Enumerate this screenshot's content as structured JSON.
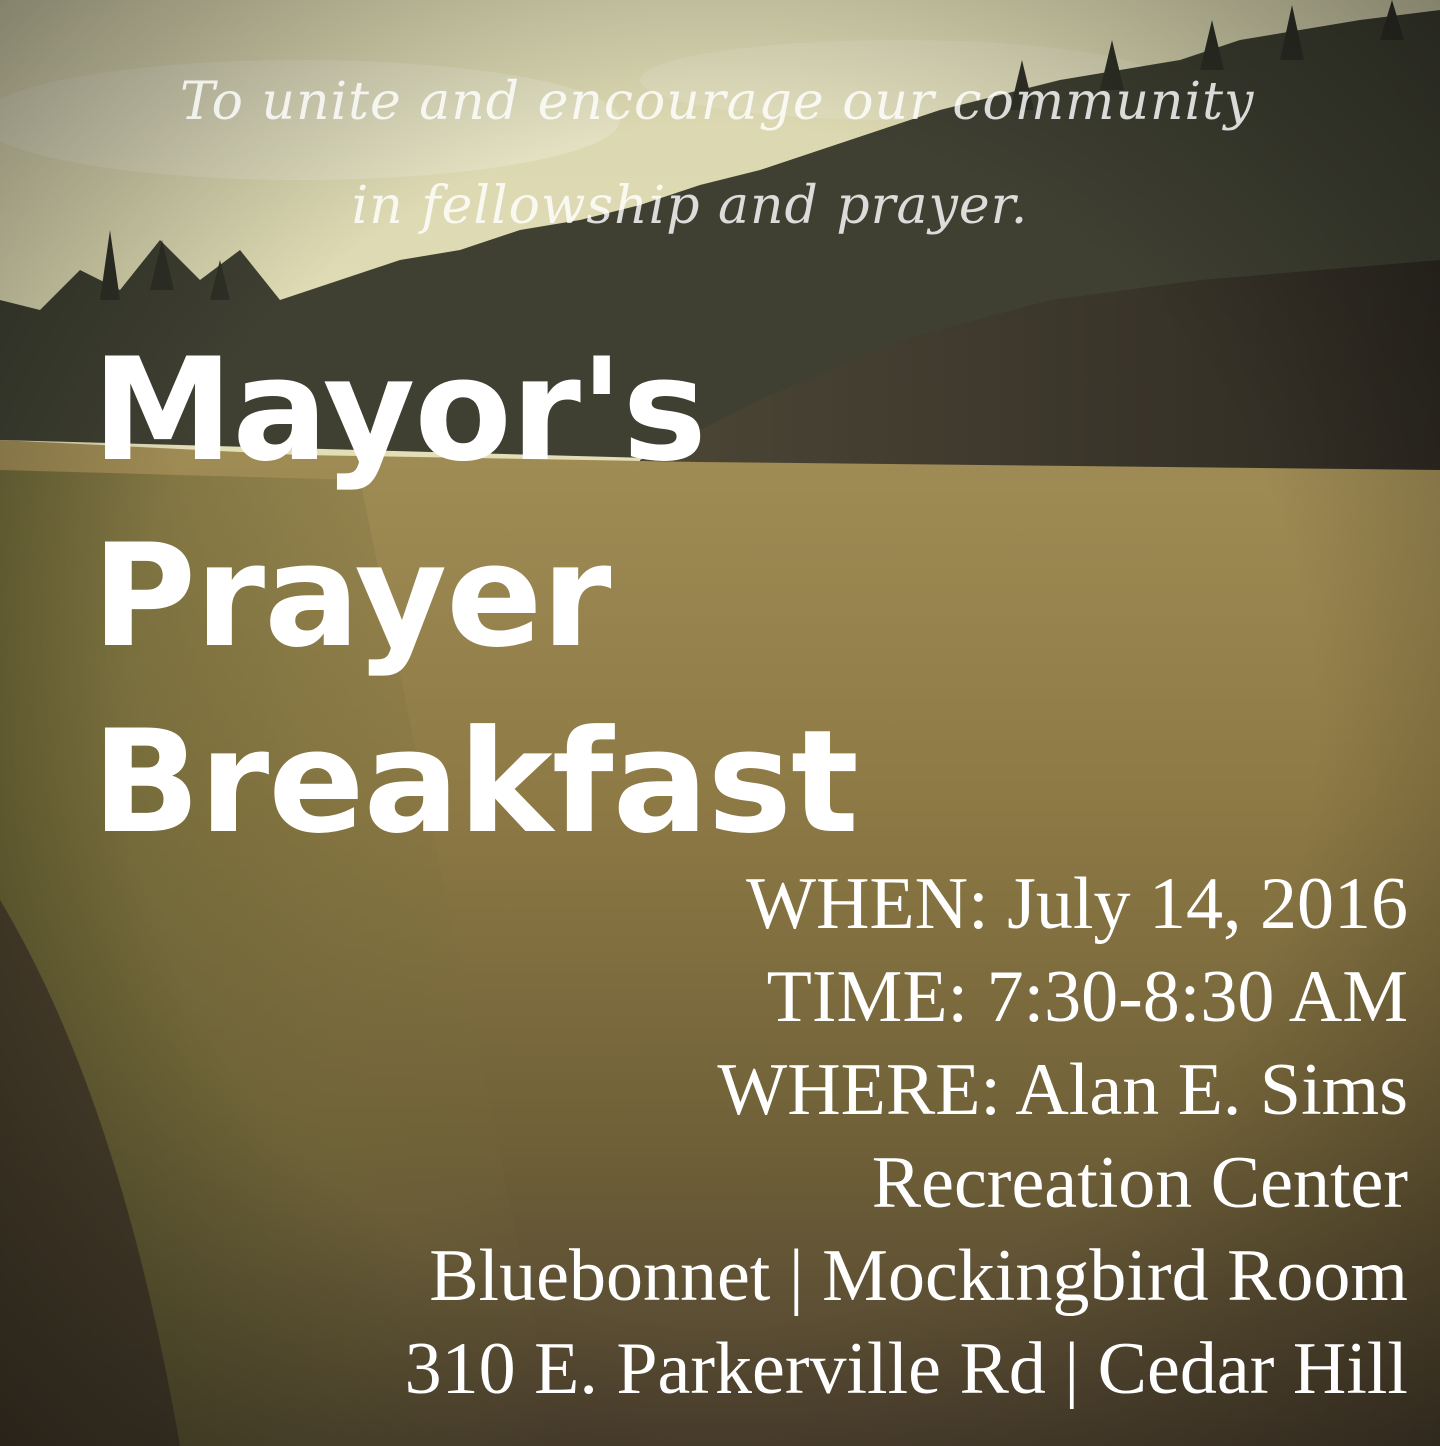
{
  "tagline": {
    "line1": "To unite and encourage our community",
    "line2": "in fellowship and prayer."
  },
  "title": {
    "line1": "Mayor's",
    "line2": "Prayer",
    "line3": "Breakfast"
  },
  "details": {
    "when": "WHEN:  July 14, 2016",
    "time": "TIME: 7:30-8:30 AM",
    "where": "WHERE: Alan E. Sims",
    "venue": "Recreation Center",
    "room": "Bluebonnet | Mockingbird Room",
    "address": "310 E. Parkerville Rd | Cedar Hill"
  },
  "colors": {
    "sky": "#e6e1b4",
    "forest": "#3a3a2a",
    "meadow": "#9c8446",
    "text": "#ffffff"
  }
}
